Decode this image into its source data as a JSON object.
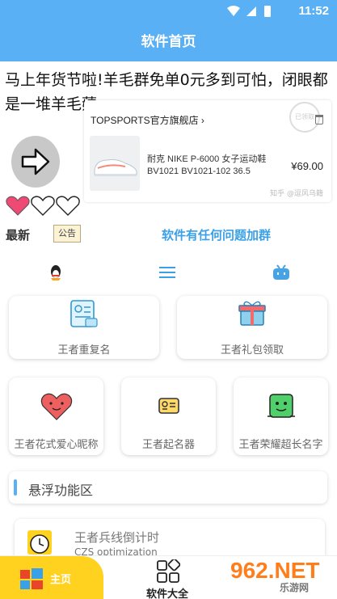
{
  "status_bar": {
    "time": "11:52"
  },
  "header": {
    "title": "软件首页"
  },
  "marquee_text": "马上年货节啦!羊毛群免单0元多到可怕，闭眼都是一堆羊毛薅",
  "ad": {
    "store": "TOPSPORTS官方旗舰店 ›",
    "product_line1": "耐克 NIKE P-6000 女子运动鞋",
    "product_line2": "BV1021 BV1021-102 36.5",
    "price": "¥69.00",
    "footer": "知乎 @逗风乌籍",
    "stamp": "已领取"
  },
  "notice": {
    "latest_label": "最新",
    "badge": "公告",
    "link": "软件有任何问题加群"
  },
  "tiles": [
    {
      "label": "王者重复名",
      "icon": "document-icon"
    },
    {
      "label": "王者礼包领取",
      "icon": "gift-icon"
    },
    {
      "label": "王者花式爱心昵称",
      "icon": "heart-icon"
    },
    {
      "label": "王者起名器",
      "icon": "id-card-icon"
    },
    {
      "label": "王者荣耀超长名字",
      "icon": "smiley-box-icon"
    }
  ],
  "section": {
    "title": "悬浮功能区"
  },
  "float_item": {
    "title": "王者兵线倒计时",
    "subtitle": "CZS optimization"
  },
  "bottom_nav": {
    "home": "主页",
    "all": "软件大全"
  },
  "watermark": {
    "brand": "962.NET",
    "sub": "乐游网"
  },
  "colors": {
    "primary": "#5ab0f5",
    "accent_yellow": "#ffd21f",
    "link": "#3aa0e8"
  }
}
